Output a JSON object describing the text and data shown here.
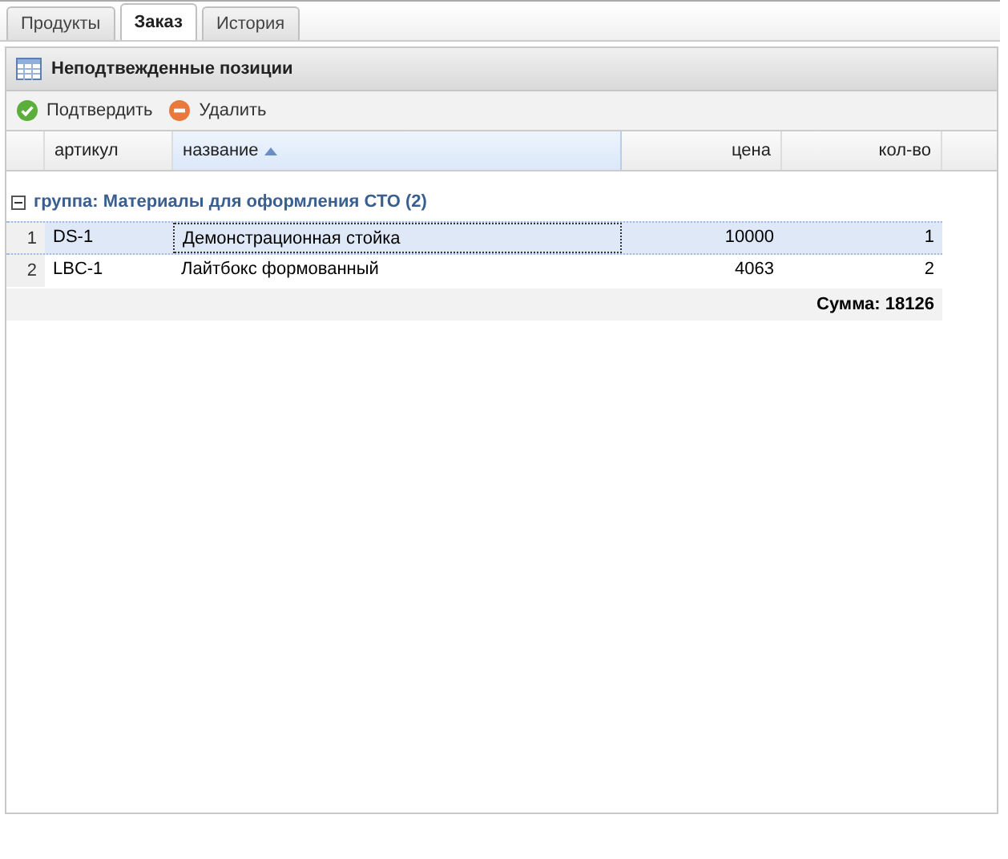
{
  "tabs": [
    {
      "label": "Продукты",
      "selected": false
    },
    {
      "label": "Заказ",
      "selected": true
    },
    {
      "label": "История",
      "selected": false
    }
  ],
  "panel": {
    "title": "Неподтвежденные позиции"
  },
  "toolbar": [
    {
      "label": "Подтвердить",
      "kind": "confirm"
    },
    {
      "label": "Удалить",
      "kind": "delete"
    }
  ],
  "table": {
    "columns": [
      {
        "label": "артикул",
        "kind": "text",
        "sorted": false
      },
      {
        "label": "название",
        "kind": "text",
        "sorted": true
      },
      {
        "label": "цена",
        "kind": "number",
        "sorted": false
      },
      {
        "label": "кол-во",
        "kind": "number",
        "sorted": false
      }
    ],
    "group": {
      "label": "группа: Материалы для оформления СТО (2)",
      "expanded": true
    },
    "rows": [
      {
        "number": "1",
        "cells": [
          "DS-1",
          "Демонстрационная стойка",
          "10000",
          "1"
        ],
        "selected": true
      },
      {
        "number": "2",
        "cells": [
          "LBC-1",
          "Лайтбокс формованный",
          "4063",
          "2"
        ],
        "selected": false
      }
    ],
    "summary": "Сумма: 18126"
  }
}
